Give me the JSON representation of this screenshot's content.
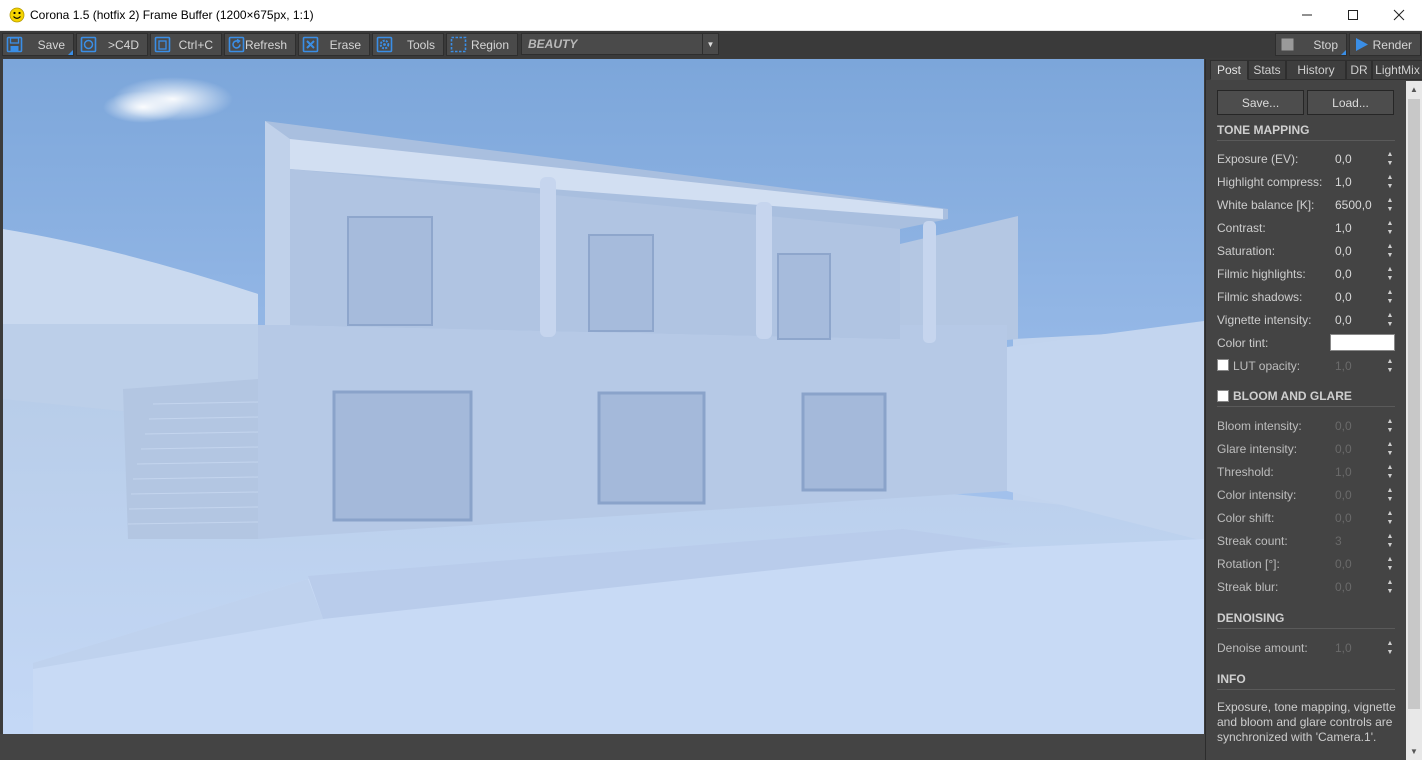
{
  "window": {
    "title": "Corona 1.5 (hotfix 2) Frame Buffer (1200×675px, 1:1)",
    "icon": "smiley-icon",
    "minimize": "—",
    "maximize": "☐",
    "close": "✕"
  },
  "toolbar": {
    "save": "Save",
    "to_c4d": ">C4D",
    "copy": "Ctrl+C",
    "refresh": "Refresh",
    "erase": "Erase",
    "tools": "Tools",
    "region": "Region",
    "channel": "BEAUTY",
    "stop": "Stop",
    "render": "Render"
  },
  "panel": {
    "tabs": [
      "Post",
      "Stats",
      "History",
      "DR",
      "LightMix"
    ],
    "save_button": "Save...",
    "load_button": "Load...",
    "tone_mapping": {
      "title": "TONE MAPPING",
      "rows": [
        {
          "label": "Exposure (EV):",
          "value": "0,0"
        },
        {
          "label": "Highlight compress:",
          "value": "1,0"
        },
        {
          "label": "White balance [K]:",
          "value": "6500,0"
        },
        {
          "label": "Contrast:",
          "value": "1,0"
        },
        {
          "label": "Saturation:",
          "value": "0,0"
        },
        {
          "label": "Filmic highlights:",
          "value": "0,0"
        },
        {
          "label": "Filmic shadows:",
          "value": "0,0"
        },
        {
          "label": "Vignette intensity:",
          "value": "0,0"
        }
      ],
      "color_tint_label": "Color tint:",
      "color_tint_value": "#ffffff",
      "lut_label": "LUT opacity:",
      "lut_value": "1,0"
    },
    "bloom": {
      "title": "BLOOM AND GLARE",
      "rows": [
        {
          "label": "Bloom intensity:",
          "value": "0,0"
        },
        {
          "label": "Glare intensity:",
          "value": "0,0"
        },
        {
          "label": "Threshold:",
          "value": "1,0"
        },
        {
          "label": "Color intensity:",
          "value": "0,0"
        },
        {
          "label": "Color shift:",
          "value": "0,0"
        },
        {
          "label": "Streak count:",
          "value": "3"
        },
        {
          "label": "Rotation [°]:",
          "value": "0,0"
        },
        {
          "label": "Streak blur:",
          "value": "0,0"
        }
      ]
    },
    "denoising": {
      "title": "DENOISING",
      "amount_label": "Denoise amount:",
      "amount_value": "1,0"
    },
    "info": {
      "title": "INFO",
      "text": "Exposure, tone mapping, vignette and bloom and glare controls are synchronized with 'Camera.1'."
    }
  },
  "colors": {
    "accent": "#3a8ee6",
    "panel_bg": "#444444",
    "toolbar_bg": "#3a3a3a"
  }
}
